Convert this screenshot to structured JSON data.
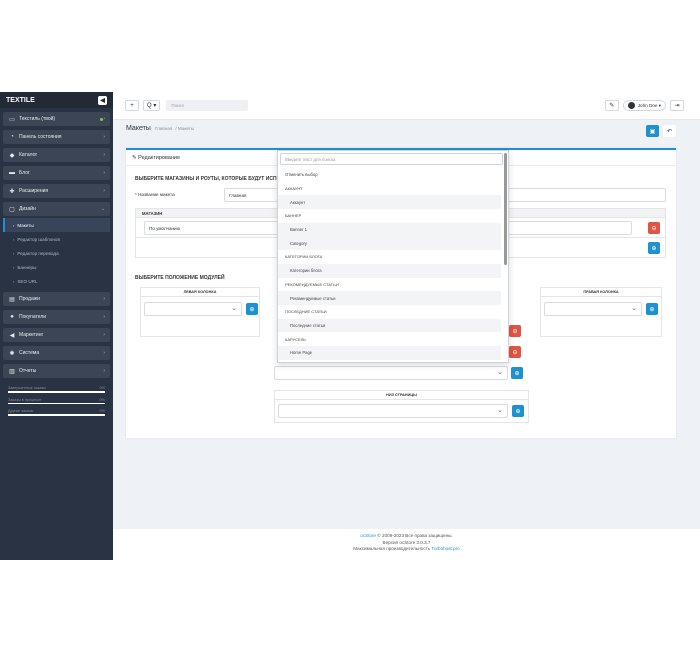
{
  "sidebar": {
    "brand": "TEXTILE",
    "items": [
      {
        "label": "Текстиль (твой)",
        "icon": "monitor-icon"
      },
      {
        "label": "Панель состояния",
        "icon": "dashboard-icon"
      },
      {
        "label": "Каталог",
        "icon": "tag-icon"
      },
      {
        "label": "Блог",
        "icon": "folder-icon"
      },
      {
        "label": "Расширения",
        "icon": "puzzle-icon"
      },
      {
        "label": "Дизайн",
        "icon": "desktop-icon"
      }
    ],
    "design_sub": [
      "Макеты",
      "Редактор шаблонов",
      "Редактор перевода",
      "Баннеры",
      "SEO URL"
    ],
    "items2": [
      {
        "label": "Продажи",
        "icon": "cart-icon"
      },
      {
        "label": "Покупатели",
        "icon": "user-icon"
      },
      {
        "label": "Маркетинг",
        "icon": "share-icon"
      },
      {
        "label": "Система",
        "icon": "gear-icon"
      },
      {
        "label": "Отчеты",
        "icon": "chart-icon"
      }
    ],
    "stats": [
      {
        "label": "Завершенные заказы",
        "value": "0%"
      },
      {
        "label": "Заказы в процессе",
        "value": "0%"
      },
      {
        "label": "Другие заказы",
        "value": "0%"
      }
    ]
  },
  "topbar": {
    "plus": "+",
    "search_label": "Q ▾",
    "search_placeholder": "Поиск",
    "user": "John Doe ▾"
  },
  "page": {
    "title": "Макеты",
    "breadcrumb": [
      "Главная",
      "Макеты"
    ]
  },
  "card": {
    "header": "Редактирование",
    "section1": "ВЫБЕРИТЕ МАГАЗИНЫ И РОУТЫ, КОТОРЫЕ БУДУТ ИСП",
    "name_label": "Название макета",
    "name_value": "Главная",
    "table_header": "МАГАЗИН",
    "store_value": "По умолчанию",
    "section2": "ВЫБЕРИТЕ ПОЛОЖЕНИЕ МОДУЛЕЙ",
    "left_col": "ЛЕВАЯ КОЛОНКА",
    "right_col": "ПРАВАЯ КОЛОНКА",
    "bottom": "НИЗ СТРАНИЦЫ"
  },
  "dropdown": {
    "placeholder": "Введите текст для поиска",
    "options": [
      {
        "t": "cancel",
        "label": "Отменить выбор"
      },
      {
        "t": "g",
        "label": "Аккаунт"
      },
      {
        "t": "o",
        "label": "Аккаунт"
      },
      {
        "t": "g",
        "label": "Баннер"
      },
      {
        "t": "o",
        "label": "Banner 1"
      },
      {
        "t": "o",
        "label": "Category"
      },
      {
        "t": "g",
        "label": "Категории блога"
      },
      {
        "t": "o",
        "label": "Категории блога"
      },
      {
        "t": "g",
        "label": "Рекомендуемые статьи"
      },
      {
        "t": "o",
        "label": "Рекомендуемые статьи"
      },
      {
        "t": "g",
        "label": "Последние статьи"
      },
      {
        "t": "o",
        "label": "Последние статьи"
      },
      {
        "t": "g",
        "label": "Карусель"
      },
      {
        "t": "o",
        "label": "Home Page"
      }
    ]
  },
  "footer": {
    "brand_link": "ocStore",
    "line1": " © 2009-2023 Все права защищены.",
    "line2": "Версия ocStore 3.0.3.7",
    "line3": "Максимальная производительность ",
    "perf_link": "Turbohost.pro"
  },
  "colors": {
    "primary": "#1e91cf",
    "danger": "#e05443",
    "sidebar": "#2a3343"
  }
}
